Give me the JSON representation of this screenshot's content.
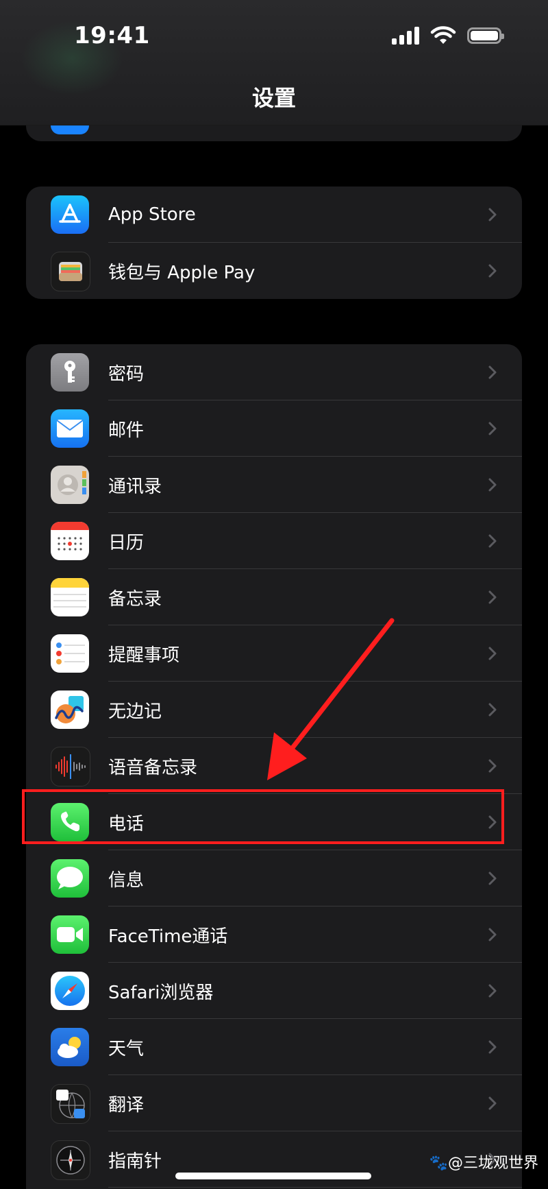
{
  "status_bar": {
    "time": "19:41"
  },
  "nav": {
    "title": "设置"
  },
  "group_store": [
    {
      "label": "App Store"
    },
    {
      "label": "钱包与 Apple Pay"
    }
  ],
  "group_apps": [
    {
      "label": "密码"
    },
    {
      "label": "邮件"
    },
    {
      "label": "通讯录"
    },
    {
      "label": "日历"
    },
    {
      "label": "备忘录"
    },
    {
      "label": "提醒事项"
    },
    {
      "label": "无边记"
    },
    {
      "label": "语音备忘录"
    },
    {
      "label": "电话"
    },
    {
      "label": "信息"
    },
    {
      "label": "FaceTime通话"
    },
    {
      "label": "Safari浏览器"
    },
    {
      "label": "天气"
    },
    {
      "label": "翻译"
    },
    {
      "label": "指南针"
    }
  ],
  "watermark": "🐾@三垅观世界",
  "colors": {
    "background": "#000000",
    "group_bg": "#1c1c1e",
    "separator": "#38383a",
    "highlight": "#ff1e1e"
  }
}
